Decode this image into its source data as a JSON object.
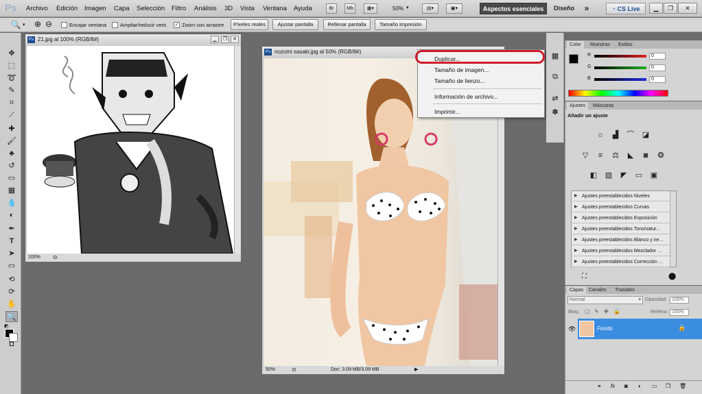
{
  "app": {
    "logo": "Ps"
  },
  "menu": [
    "Archivo",
    "Edición",
    "Imagen",
    "Capa",
    "Selección",
    "Filtro",
    "Análisis",
    "3D",
    "Vista",
    "Ventana",
    "Ayuda"
  ],
  "menubar_buttons": {
    "br": "Br",
    "mb": "Mb",
    "zoom": "50%"
  },
  "workspace": {
    "active": "Aspectos esenciales",
    "other": "Diseño",
    "more": "»",
    "cslive": "CS Live"
  },
  "options": {
    "checks": [
      {
        "label": "Encajar ventana",
        "checked": false
      },
      {
        "label": "Ampliar/reducir vent.",
        "checked": false
      },
      {
        "label": "Zoom con arrastre",
        "checked": true
      }
    ],
    "buttons": [
      "Píxeles reales",
      "Ajustar pantalla",
      "Rellenar pantalla",
      "Tamaño impresión"
    ]
  },
  "doc1": {
    "title": "21.jpg al 100% (RGB/8#)",
    "zoom": "100%"
  },
  "doc2": {
    "title": "nozomi sasaki.jpg al 50% (RGB/8#)",
    "zoom": "50%",
    "status": "Doc: 3.09 MB/3.09 MB"
  },
  "context_menu": [
    "Duplicar...",
    "Tamaño de imagen...",
    "Tamaño de lienzo...",
    "Información de archivo...",
    "Imprimir..."
  ],
  "color_panel": {
    "tabs": [
      "Color",
      "Muestras",
      "Estilos"
    ],
    "channels": [
      {
        "label": "R",
        "value": "0",
        "color": "#e02020"
      },
      {
        "label": "G",
        "value": "0",
        "color": "#20b020"
      },
      {
        "label": "B",
        "value": "0",
        "color": "#2030e0"
      }
    ]
  },
  "adjust_panel": {
    "tabs": [
      "Ajustes",
      "Máscaras"
    ],
    "heading": "Añadir un ajuste",
    "presets": [
      "Ajustes preestablecidos Niveles",
      "Ajustes preestablecidos Curvas",
      "Ajustes preestablecidos Exposición",
      "Ajustes preestablecidos Tono/satur...",
      "Ajustes preestablecidos Blanco y ne...",
      "Ajustes preestablecidos Mezclador ...",
      "Ajustes preestablecidos Corrección ..."
    ]
  },
  "layers_panel": {
    "tabs": [
      "Capas",
      "Canales",
      "Trazados"
    ],
    "blend": "Normal",
    "opacity_label": "Opacidad:",
    "opacity": "100%",
    "lock_label": "Bloq.:",
    "fill_label": "Relleno:",
    "fill": "100%",
    "layer_name": "Fondo"
  }
}
